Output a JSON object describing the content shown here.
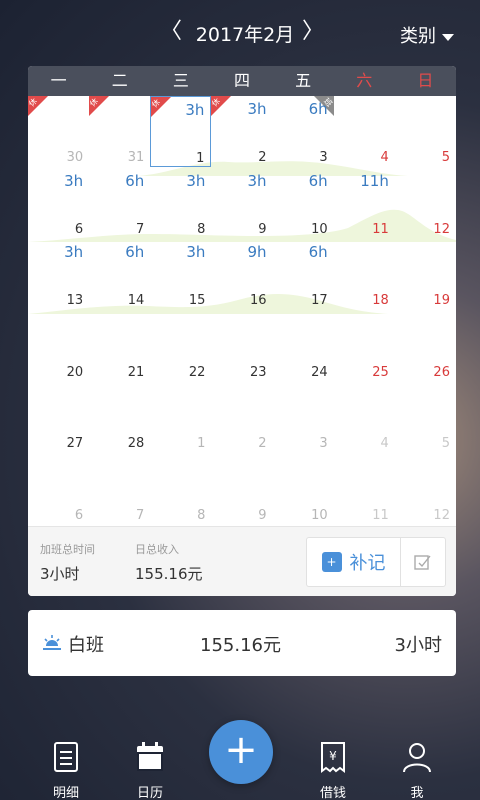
{
  "header": {
    "prev": "〈",
    "next": "〉",
    "month": "2017年2月",
    "category": "类别"
  },
  "weekdays": [
    "一",
    "二",
    "三",
    "四",
    "五",
    "六",
    "日"
  ],
  "calendar": {
    "rows": [
      [
        {
          "hrs": "",
          "day": "30",
          "dim": true,
          "tag": "休"
        },
        {
          "hrs": "",
          "day": "31",
          "dim": true,
          "tag": "休"
        },
        {
          "hrs": "3h",
          "day": "1",
          "tag": "休",
          "today": true
        },
        {
          "hrs": "3h",
          "day": "2",
          "tag": "休"
        },
        {
          "hrs": "6h",
          "day": "3",
          "tag_gray": "班"
        },
        {
          "hrs": "",
          "day": "4",
          "red": true
        },
        {
          "hrs": "",
          "day": "5",
          "red": true
        }
      ],
      [
        {
          "hrs": "3h",
          "day": "6"
        },
        {
          "hrs": "6h",
          "day": "7"
        },
        {
          "hrs": "3h",
          "day": "8"
        },
        {
          "hrs": "3h",
          "day": "9"
        },
        {
          "hrs": "6h",
          "day": "10"
        },
        {
          "hrs": "11h",
          "day": "11",
          "red": true
        },
        {
          "hrs": "",
          "day": "12",
          "red": true
        }
      ],
      [
        {
          "hrs": "3h",
          "day": "13"
        },
        {
          "hrs": "6h",
          "day": "14"
        },
        {
          "hrs": "3h",
          "day": "15"
        },
        {
          "hrs": "9h",
          "day": "16"
        },
        {
          "hrs": "6h",
          "day": "17"
        },
        {
          "hrs": "",
          "day": "18",
          "red": true
        },
        {
          "hrs": "",
          "day": "19",
          "red": true
        }
      ],
      [
        {
          "hrs": "",
          "day": "20"
        },
        {
          "hrs": "",
          "day": "21"
        },
        {
          "hrs": "",
          "day": "22"
        },
        {
          "hrs": "",
          "day": "23"
        },
        {
          "hrs": "",
          "day": "24"
        },
        {
          "hrs": "",
          "day": "25",
          "red": true
        },
        {
          "hrs": "",
          "day": "26",
          "red": true
        }
      ],
      [
        {
          "hrs": "",
          "day": "27"
        },
        {
          "hrs": "",
          "day": "28"
        },
        {
          "hrs": "",
          "day": "1",
          "dim": true
        },
        {
          "hrs": "",
          "day": "2",
          "dim": true
        },
        {
          "hrs": "",
          "day": "3",
          "dim": true
        },
        {
          "hrs": "",
          "day": "4",
          "dim": true,
          "red": true
        },
        {
          "hrs": "",
          "day": "5",
          "dim": true,
          "red": true
        }
      ],
      [
        {
          "hrs": "",
          "day": "6",
          "dim": true
        },
        {
          "hrs": "",
          "day": "7",
          "dim": true
        },
        {
          "hrs": "",
          "day": "8",
          "dim": true
        },
        {
          "hrs": "",
          "day": "9",
          "dim": true
        },
        {
          "hrs": "",
          "day": "10",
          "dim": true
        },
        {
          "hrs": "",
          "day": "11",
          "dim": true,
          "red": true
        },
        {
          "hrs": "",
          "day": "12",
          "dim": true,
          "red": true
        }
      ]
    ]
  },
  "stats": {
    "overtime_label": "加班总时间",
    "overtime_value": "3小时",
    "income_label": "日总收入",
    "income_value": "155.16元",
    "add_record": "补记"
  },
  "shift": {
    "name": "白班",
    "amount": "155.16元",
    "hours": "3小时"
  },
  "tabs": {
    "detail": "明细",
    "calendar": "日历",
    "add": "+",
    "borrow": "借钱",
    "me": "我"
  },
  "colors": {
    "accent": "#4a90d9",
    "weekend": "#d83a3a",
    "hours": "#3a7bc0",
    "header_bg": "#4a4f5c"
  }
}
